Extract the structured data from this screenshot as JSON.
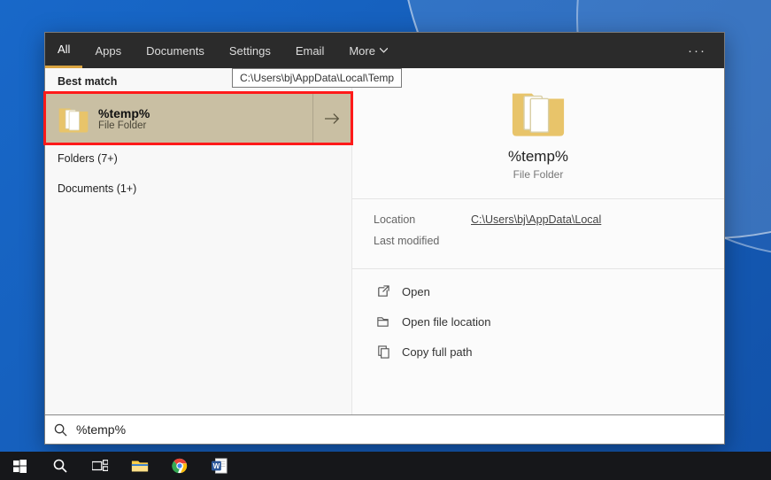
{
  "tabs": {
    "all": "All",
    "apps": "Apps",
    "documents": "Documents",
    "settings": "Settings",
    "email": "Email",
    "more": "More"
  },
  "tooltip": "C:\\Users\\bj\\AppData\\Local\\Temp",
  "left": {
    "best_match": "Best match",
    "result": {
      "title": "%temp%",
      "subtitle": "File Folder"
    },
    "cat_folders": "Folders (7+)",
    "cat_documents": "Documents (1+)"
  },
  "preview": {
    "title": "%temp%",
    "subtitle": "File Folder",
    "location_label": "Location",
    "location_value": "C:\\Users\\bj\\AppData\\Local",
    "modified_label": "Last modified"
  },
  "actions": {
    "open": "Open",
    "open_location": "Open file location",
    "copy_path": "Copy full path"
  },
  "search": {
    "query": "%temp%"
  }
}
